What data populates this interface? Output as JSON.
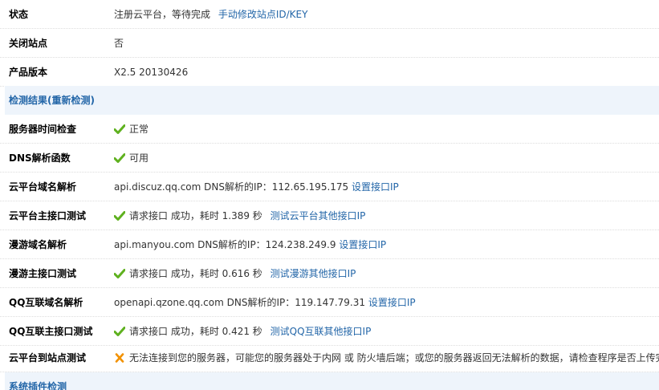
{
  "status": {
    "label": "状态",
    "text": "注册云平台，等待完成",
    "link": "手动修改站点ID/KEY"
  },
  "close_site": {
    "label": "关闭站点",
    "value": "否"
  },
  "product_version": {
    "label": "产品版本",
    "value": "X2.5 20130426"
  },
  "check_results": {
    "title": "检测结果",
    "recheck_open": "(",
    "recheck_link": "重新检测",
    "recheck_close": ")"
  },
  "server_time": {
    "label": "服务器时间检查",
    "icon": "check-icon",
    "text": "正常"
  },
  "dns_func": {
    "label": "DNS解析函数",
    "icon": "check-icon",
    "text": "可用"
  },
  "cloud_dns": {
    "label": "云平台域名解析",
    "text": "api.discuz.qq.com DNS解析的IP：112.65.195.175",
    "link": "设置接口IP"
  },
  "cloud_api": {
    "label": "云平台主接口测试",
    "icon": "check-icon",
    "text": "请求接口 成功，耗时 1.389 秒",
    "link": "测试云平台其他接口IP"
  },
  "manyou_dns": {
    "label": "漫游域名解析",
    "text": "api.manyou.com DNS解析的IP：124.238.249.9",
    "link": "设置接口IP"
  },
  "manyou_api": {
    "label": "漫游主接口测试",
    "icon": "check-icon",
    "text": "请求接口 成功，耗时 0.616 秒",
    "link": "测试漫游其他接口IP"
  },
  "qq_dns": {
    "label": "QQ互联域名解析",
    "text": "openapi.qzone.qq.com DNS解析的IP：119.147.79.31",
    "link": "设置接口IP"
  },
  "qq_api": {
    "label": "QQ互联主接口测试",
    "icon": "check-icon",
    "text": "请求接口 成功，耗时 0.421 秒",
    "link": "测试QQ互联其他接口IP"
  },
  "cloud_to_site": {
    "label": "云平台到站点测试",
    "icon": "cross-icon",
    "text": "无法连接到您的服务器，可能您的服务器处于内网 或 防火墙后端；或您的服务器返回无法解析的数据，请检查程序是否上传完整"
  },
  "plugin_check": {
    "title": "系统插件检测"
  },
  "colors": {
    "link": "#2366a8",
    "section_bg": "#eef4fb",
    "check_green": "#5fb11f",
    "cross_orange": "#f29100"
  }
}
